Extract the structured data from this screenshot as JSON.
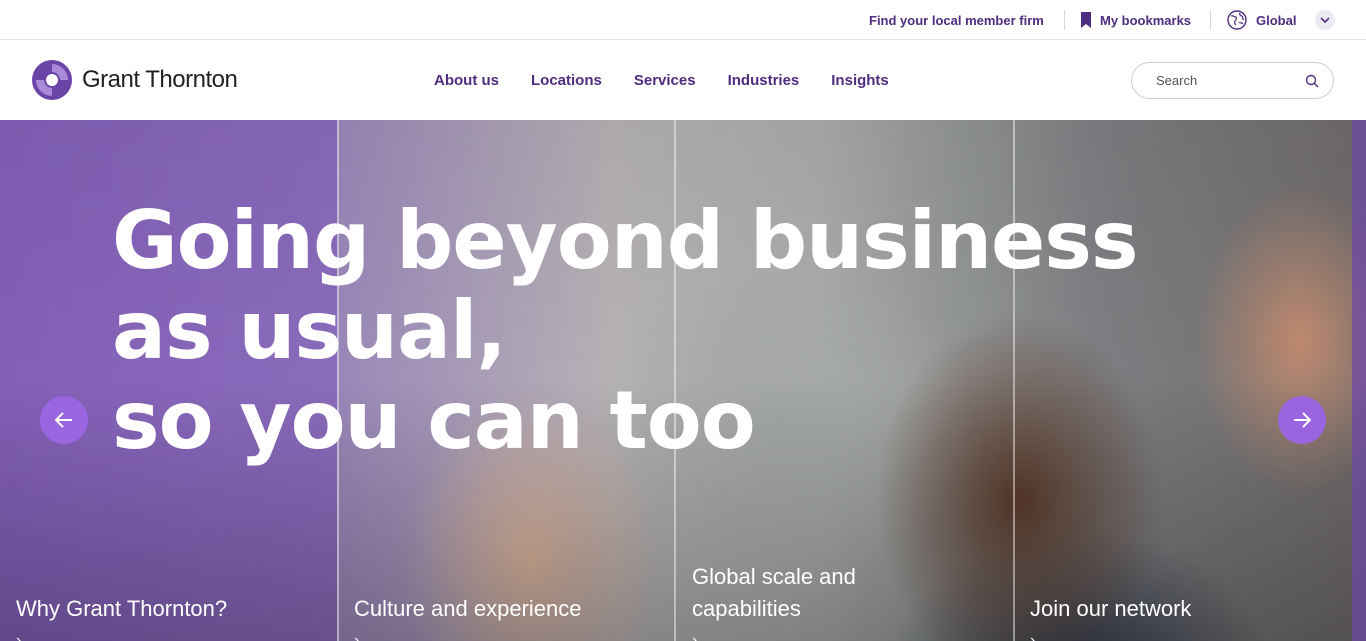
{
  "utility_bar": {
    "find_firm": "Find your local member firm",
    "bookmarks": "My bookmarks",
    "global": "Global"
  },
  "header": {
    "logo_text": "Grant Thornton",
    "nav": [
      "About us",
      "Locations",
      "Services",
      "Industries",
      "Insights"
    ],
    "search_placeholder": "Search"
  },
  "hero": {
    "heading_lines": [
      "Going beyond business",
      "as usual,",
      "so you can too"
    ],
    "panels": [
      {
        "label": "Why Grant Thornton?"
      },
      {
        "label": "Culture and experience"
      },
      {
        "label_lines": [
          "Global scale and",
          "capabilities"
        ]
      },
      {
        "label": "Join our network"
      }
    ]
  },
  "colors": {
    "brand_purple": "#4f2d7f",
    "accent_purple": "#9966e0"
  },
  "icons": {
    "bookmark": "bookmark-icon",
    "globe": "globe-icon",
    "chevron": "chevron-down-icon",
    "search": "search-icon",
    "prev": "arrow-left-icon",
    "next": "arrow-right-icon"
  }
}
